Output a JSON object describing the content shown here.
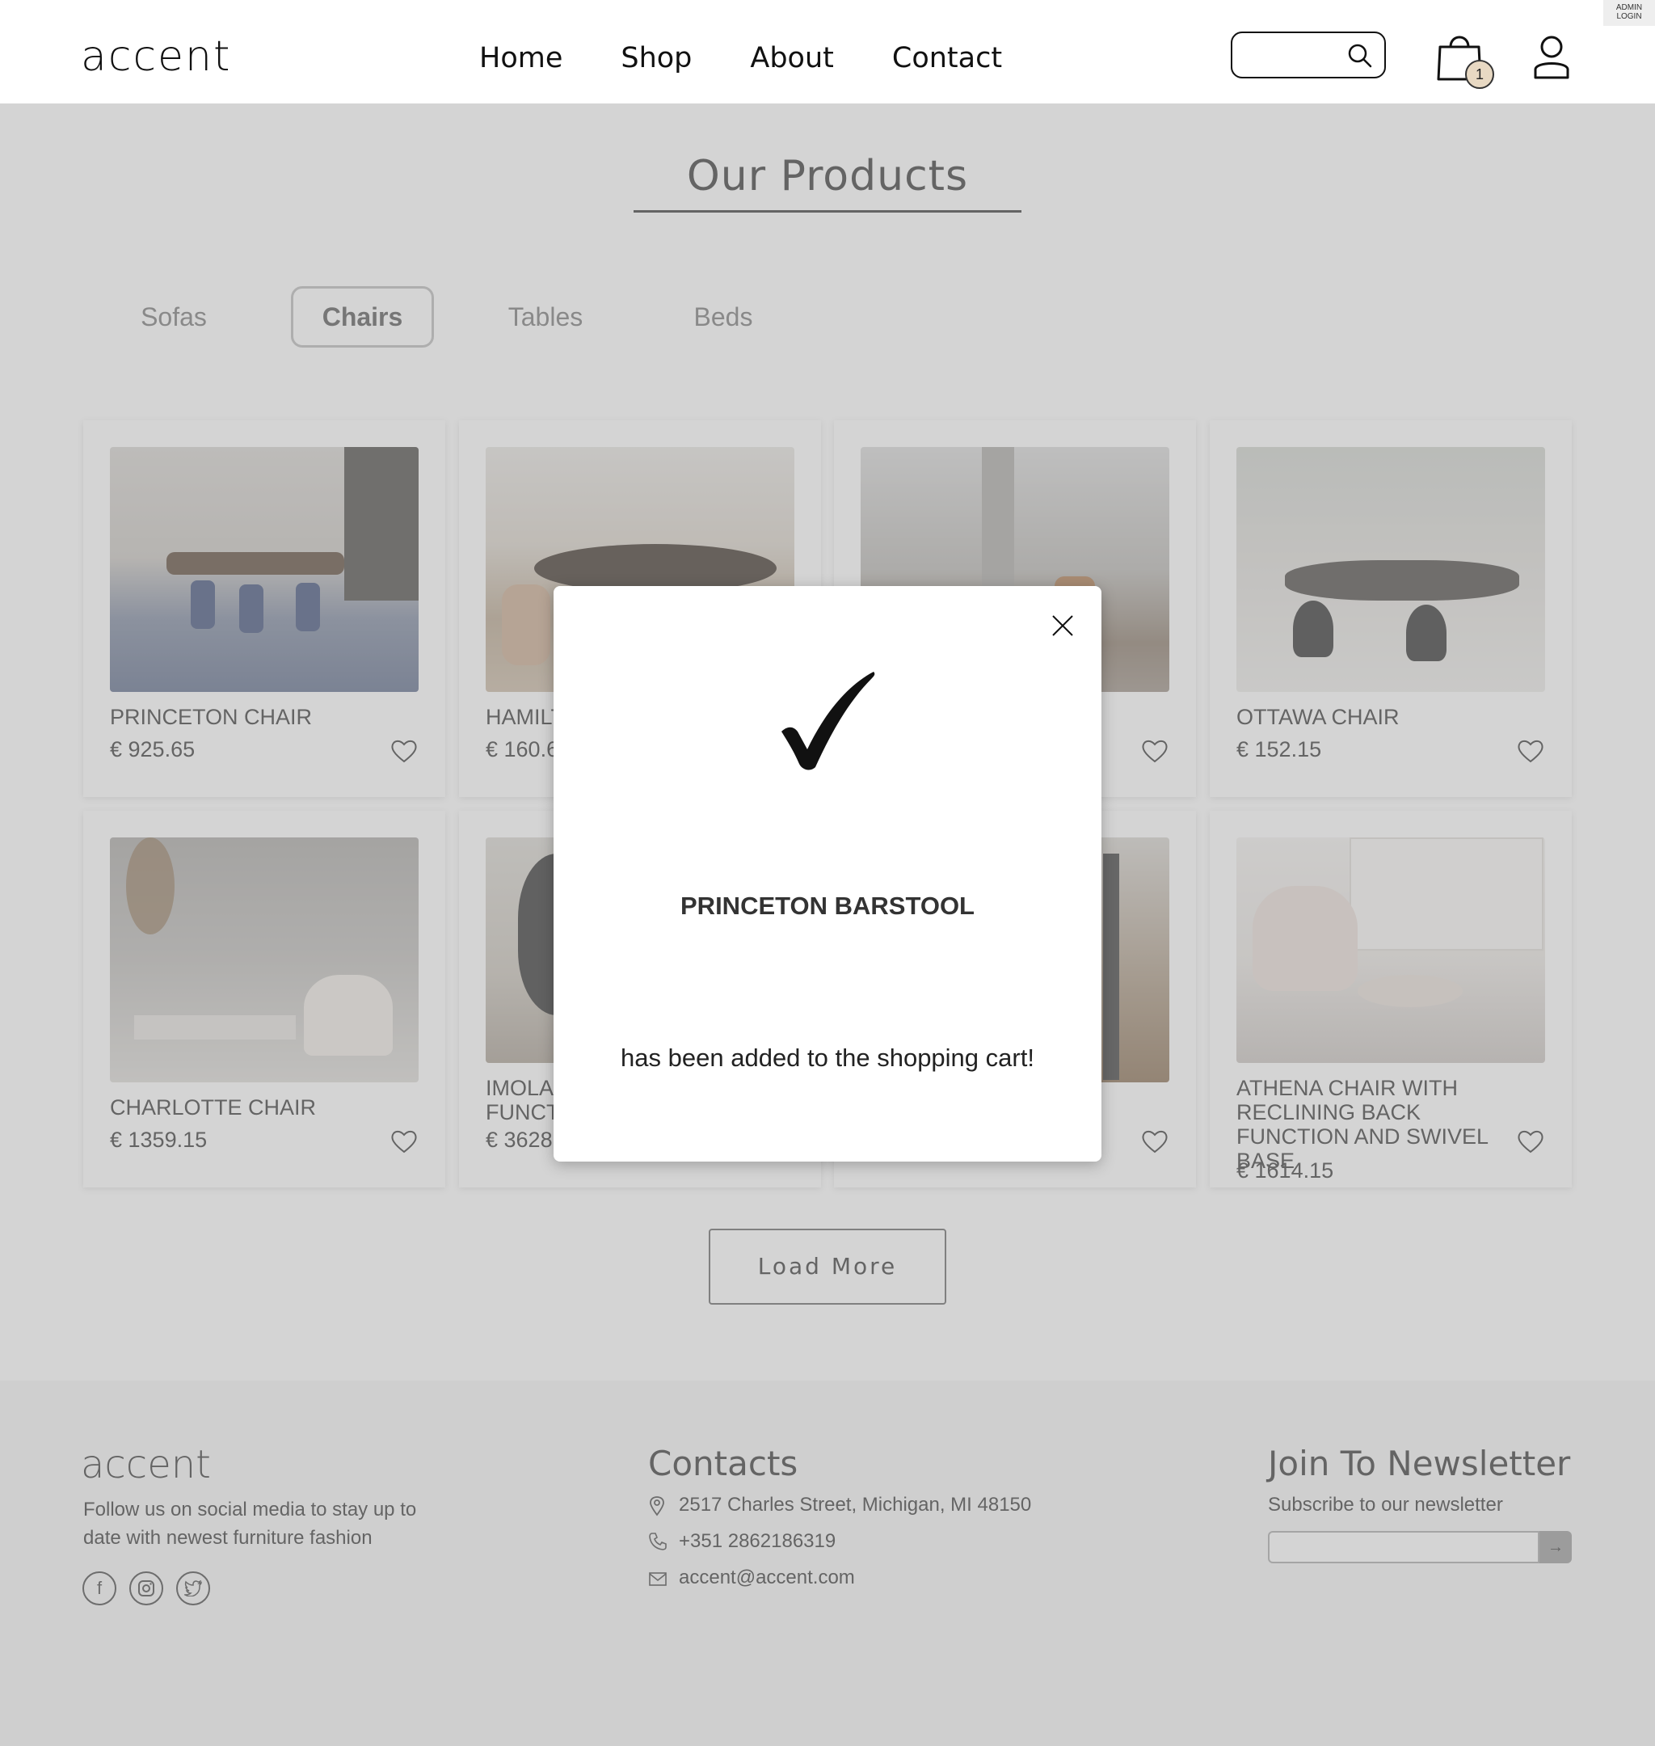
{
  "header": {
    "logo": "accent",
    "nav": [
      "Home",
      "Shop",
      "About",
      "Contact"
    ],
    "search": {
      "placeholder": ""
    },
    "cart_count": "1",
    "admin_label": "ADMIN LOGIN"
  },
  "main": {
    "title": "Our Products",
    "tabs": [
      "Sofas",
      "Chairs",
      "Tables",
      "Beds"
    ],
    "active_tab": "Chairs",
    "products": [
      {
        "name": "PRINCETON CHAIR",
        "price": "€ 925.65"
      },
      {
        "name": "HAMILT",
        "price": "€ 160.6"
      },
      {
        "name": "",
        "price": ""
      },
      {
        "name": "OTTAWA CHAIR",
        "price": "€ 152.15"
      },
      {
        "name": "CHARLOTTE CHAIR",
        "price": "€ 1359.15"
      },
      {
        "name": "IMOLA FUNCT",
        "price": "€ 3628."
      },
      {
        "name": "",
        "price": ""
      },
      {
        "name": "ATHENA CHAIR WITH RECLINING BACK FUNCTION AND SWIVEL BASE",
        "price": "€ 1614.15"
      }
    ],
    "load_more": "Load More"
  },
  "footer": {
    "logo": "accent",
    "text": "Follow us on social media to stay up to date with newest furniture fashion",
    "socials": [
      "facebook-icon",
      "instagram-icon",
      "twitter-icon"
    ],
    "contacts_title": "Contacts",
    "address": "2517 Charles Street, Michigan, MI 48150",
    "phone": "+351 2862186319",
    "email": "accent@accent.com",
    "newsletter_title": "Join To Newsletter",
    "newsletter_sub": "Subscribe to our newsletter",
    "newsletter_placeholder": ""
  },
  "modal": {
    "product": "PRINCETON BARSTOOL",
    "message": "has been added to the shopping cart!"
  },
  "colors": {
    "overlay": "#a0a0a0",
    "badge": "#e8d9c3",
    "text": "#333333"
  }
}
